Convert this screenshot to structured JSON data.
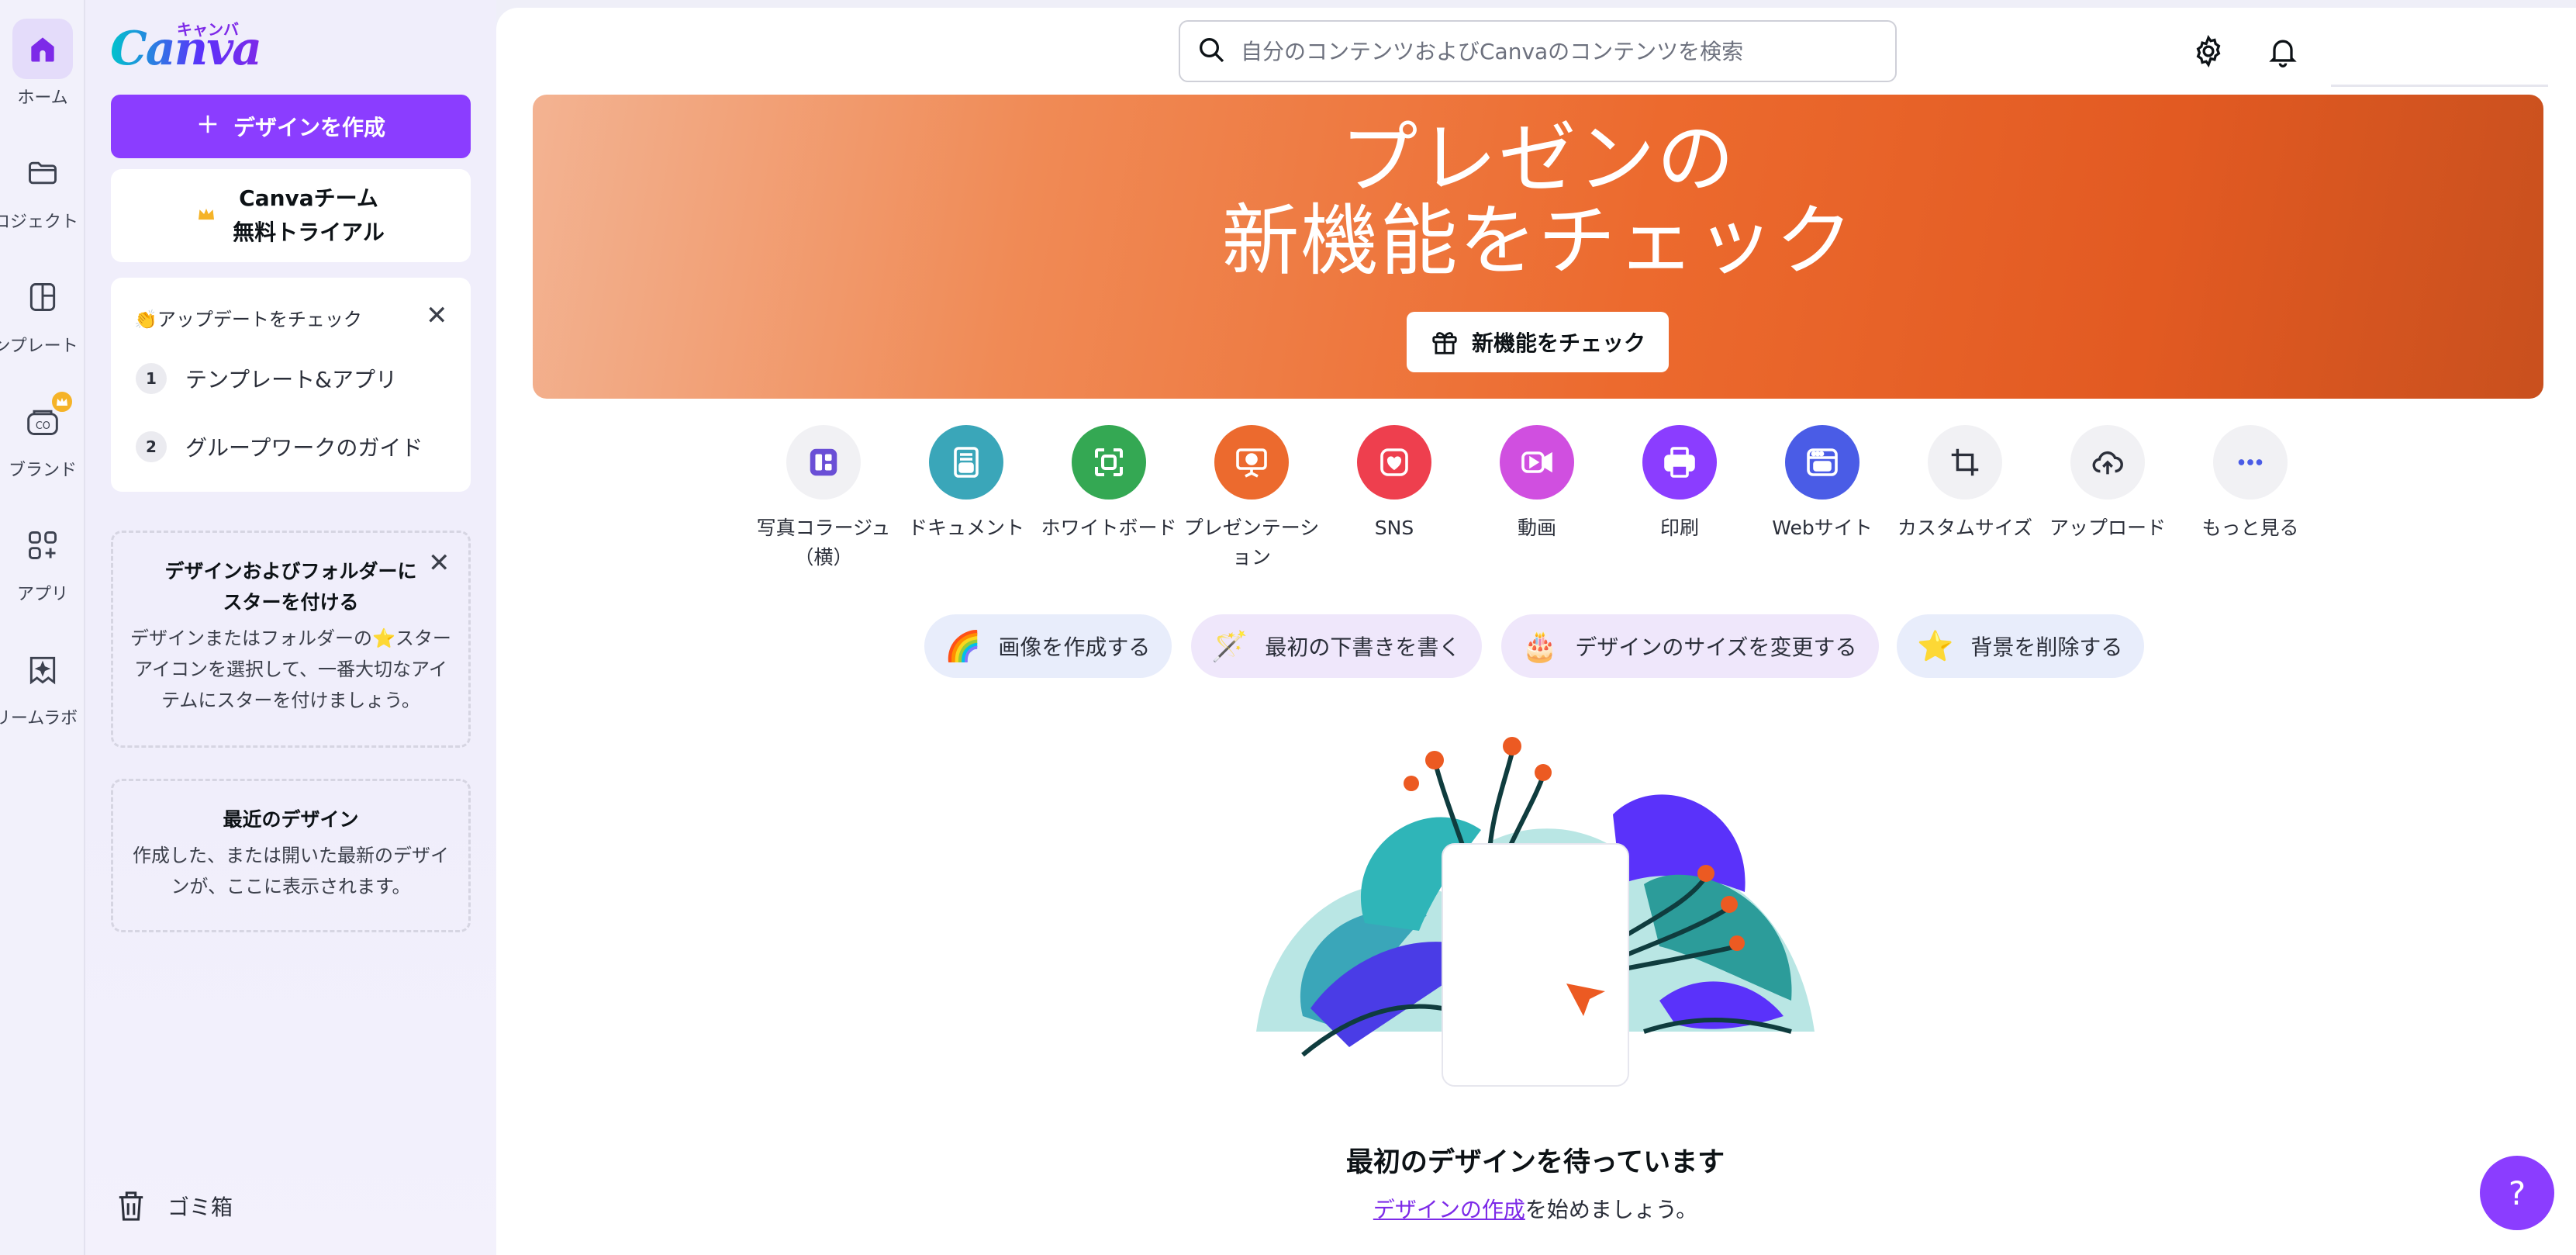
{
  "rail": {
    "items": [
      {
        "label": "ホーム",
        "icon": "home-icon"
      },
      {
        "label": "プロジェクト",
        "icon": "folder-icon"
      },
      {
        "label": "テンプレート",
        "icon": "template-icon"
      },
      {
        "label": "ブランド",
        "icon": "brand-icon"
      },
      {
        "label": "アプリ",
        "icon": "apps-icon"
      },
      {
        "label": "ドリームラボ",
        "icon": "dream-lab-icon"
      }
    ]
  },
  "panel": {
    "logo_kana": "キャンバ",
    "logo_text": "Canva",
    "create_label": "デザインを作成",
    "trial_line1": "Canvaチーム",
    "trial_line2": "無料トライアル",
    "update_title": "👏アップデートをチェック",
    "steps": [
      {
        "num": "1",
        "label": "テンプレート&アプリ"
      },
      {
        "num": "2",
        "label": "グループワークのガイド"
      }
    ],
    "star_title": "デザインおよびフォルダーにスターを付ける",
    "star_body": "デザインまたはフォルダーの⭐スターアイコンを選択して、一番大切なアイテムにスターを付けましょう。",
    "recent_title": "最近のデザイン",
    "recent_body": "作成した、または開いた最新のデザインが、ここに表示されます。",
    "trash_label": "ゴミ箱"
  },
  "search": {
    "placeholder": "自分のコンテンツおよびCanvaのコンテンツを検索"
  },
  "hero": {
    "line1": "プレゼンの",
    "line2": "新機能をチェック",
    "button_label": "新機能をチェック"
  },
  "doc_types": [
    {
      "label": "写真コラージュ（横）",
      "color": "#f1f1f4"
    },
    {
      "label": "ドキュメント",
      "color": "#3aa6b9"
    },
    {
      "label": "ホワイトボード",
      "color": "#34a853"
    },
    {
      "label": "プレゼンテーション",
      "color": "#ec6a2e"
    },
    {
      "label": "SNS",
      "color": "#ee3f4e"
    },
    {
      "label": "動画",
      "color": "#d04fe0"
    },
    {
      "label": "印刷",
      "color": "#8b3dff"
    },
    {
      "label": "Webサイト",
      "color": "#4a5ce6"
    },
    {
      "label": "カスタムサイズ",
      "color": "#f1f1f4"
    },
    {
      "label": "アップロード",
      "color": "#f1f1f4"
    },
    {
      "label": "もっと見る",
      "color": "#f1f1f4"
    }
  ],
  "chips": [
    {
      "label": "画像を作成する",
      "glyph": "🌈",
      "color": "#e8edfb"
    },
    {
      "label": "最初の下書きを書く",
      "glyph": "🪄",
      "color": "#efe7fb"
    },
    {
      "label": "デザインのサイズを変更する",
      "glyph": "🎂",
      "color": "#efe7fb"
    },
    {
      "label": "背景を削除する",
      "glyph": "⭐",
      "color": "#e8edfb"
    }
  ],
  "empty": {
    "title": "最初のデザインを待っています",
    "link": "デザインの作成",
    "rest": "を始めましょう。"
  },
  "help": {
    "label": "?"
  },
  "colors": {
    "accent": "#8b3dff",
    "hero_orange": "#ec6a2e"
  }
}
